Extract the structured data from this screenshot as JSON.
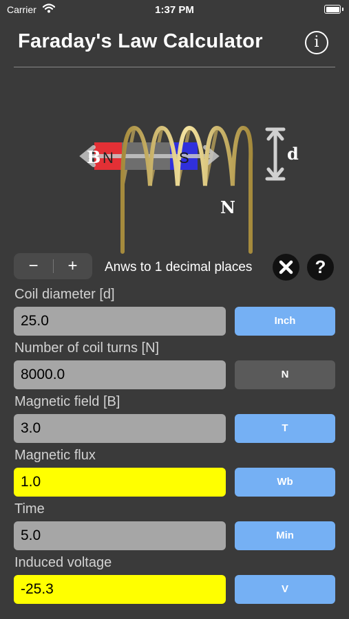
{
  "status_bar": {
    "carrier": "Carrier",
    "time": "1:37 PM"
  },
  "header": {
    "title": "Faraday's Law Calculator",
    "info_label": "i"
  },
  "diagram": {
    "b_label": "B",
    "n_pole": "N",
    "s_pole": "S",
    "d_label": "d",
    "turns_label": "N"
  },
  "controls": {
    "minus": "−",
    "plus": "+",
    "decimals_text": "Anws to 1 decimal places",
    "help_label": "?"
  },
  "fields": [
    {
      "label": "Coil diameter [d]",
      "value": "25.0",
      "unit": "Inch"
    },
    {
      "label": "Number of coil turns [N]",
      "value": "8000.0",
      "unit": "N"
    },
    {
      "label": "Magnetic field [B]",
      "value": "3.0",
      "unit": "T"
    },
    {
      "label": "Magnetic flux",
      "value": "1.0",
      "unit": "Wb"
    },
    {
      "label": "Time",
      "value": "5.0",
      "unit": "Min"
    },
    {
      "label": "Induced voltage",
      "value": "-25.3",
      "unit": "V"
    }
  ],
  "colors": {
    "background": "#3a3a3a",
    "unit_button": "#75b0f4",
    "result_field": "#ffff00",
    "input_field": "#a6a6a6"
  }
}
